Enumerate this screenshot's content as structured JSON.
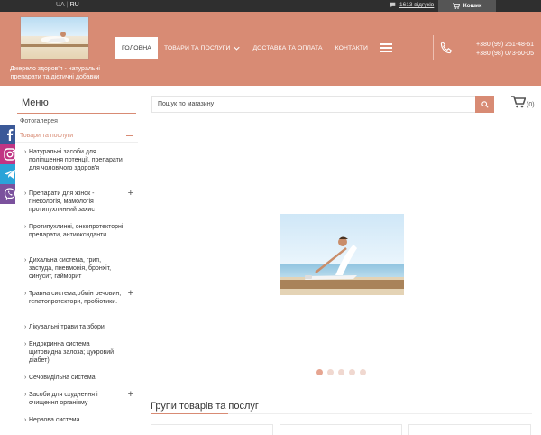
{
  "topbar": {
    "languages": [
      "UA",
      "RU"
    ],
    "active_language": "RU",
    "reviews_label": "1613 відгуків",
    "cart_label": "Кошик"
  },
  "header": {
    "logo_text": "Джерело здоров'я - натуральні препарати та дієтичні добавки",
    "nav": [
      "ГОЛОВНА",
      "ТОВАРИ ТА ПОСЛУГИ",
      "ДОСТАВКА ТА ОПЛАТА",
      "КОНТАКТИ"
    ],
    "phones": [
      "+380 (99) 251-48-61",
      "+380 (98) 073-60-05"
    ]
  },
  "sidebar": {
    "title": "Меню",
    "gallery_label": "Фотогалерея",
    "category_label": "Товари та послуги",
    "items": [
      {
        "label": "Натуральні засоби для поліпшення потенції, препарати для чоловічого здоров'я",
        "expandable": false
      },
      {
        "label": "Препарати для жінок - гінекологія, мамологія і протипухлинний захист",
        "expandable": true
      },
      {
        "label": "Протипухлинні, онкопротекторні препарати, антиоксиданти",
        "expandable": false
      },
      {
        "label": "Дихальна система, грип, застуда, пневмонія, бронхіт, синусит, гайморит",
        "expandable": false
      },
      {
        "label": "Травна система,обмін речовин, гепатопротектори, пробіотики.",
        "expandable": true
      },
      {
        "label": "Лікувальні трави та збори",
        "expandable": false
      },
      {
        "label": "Ендокринна система щитовидна залоза; цукровий діабет)",
        "expandable": false
      },
      {
        "label": "Сечовидільна система",
        "expandable": false
      },
      {
        "label": "Засоби для схуднення і очищення організму",
        "expandable": true
      },
      {
        "label": "Нервова система.",
        "expandable": false
      }
    ]
  },
  "search": {
    "placeholder": "Пошук по магазину"
  },
  "cart_count": "(0)",
  "slider": {
    "slide_count": 5,
    "active_slide": 1
  },
  "groups_title": "Групи товарів та послуг",
  "social": [
    {
      "icon": "facebook-icon",
      "color": "#3b5998"
    },
    {
      "icon": "instagram-icon",
      "color": "#c13584"
    },
    {
      "icon": "telegram-icon",
      "color": "#2aa3d8"
    },
    {
      "icon": "viber-icon",
      "color": "#7b519d"
    }
  ],
  "colors": {
    "brand": "#d88b74",
    "topbar": "#2f2f2f"
  }
}
